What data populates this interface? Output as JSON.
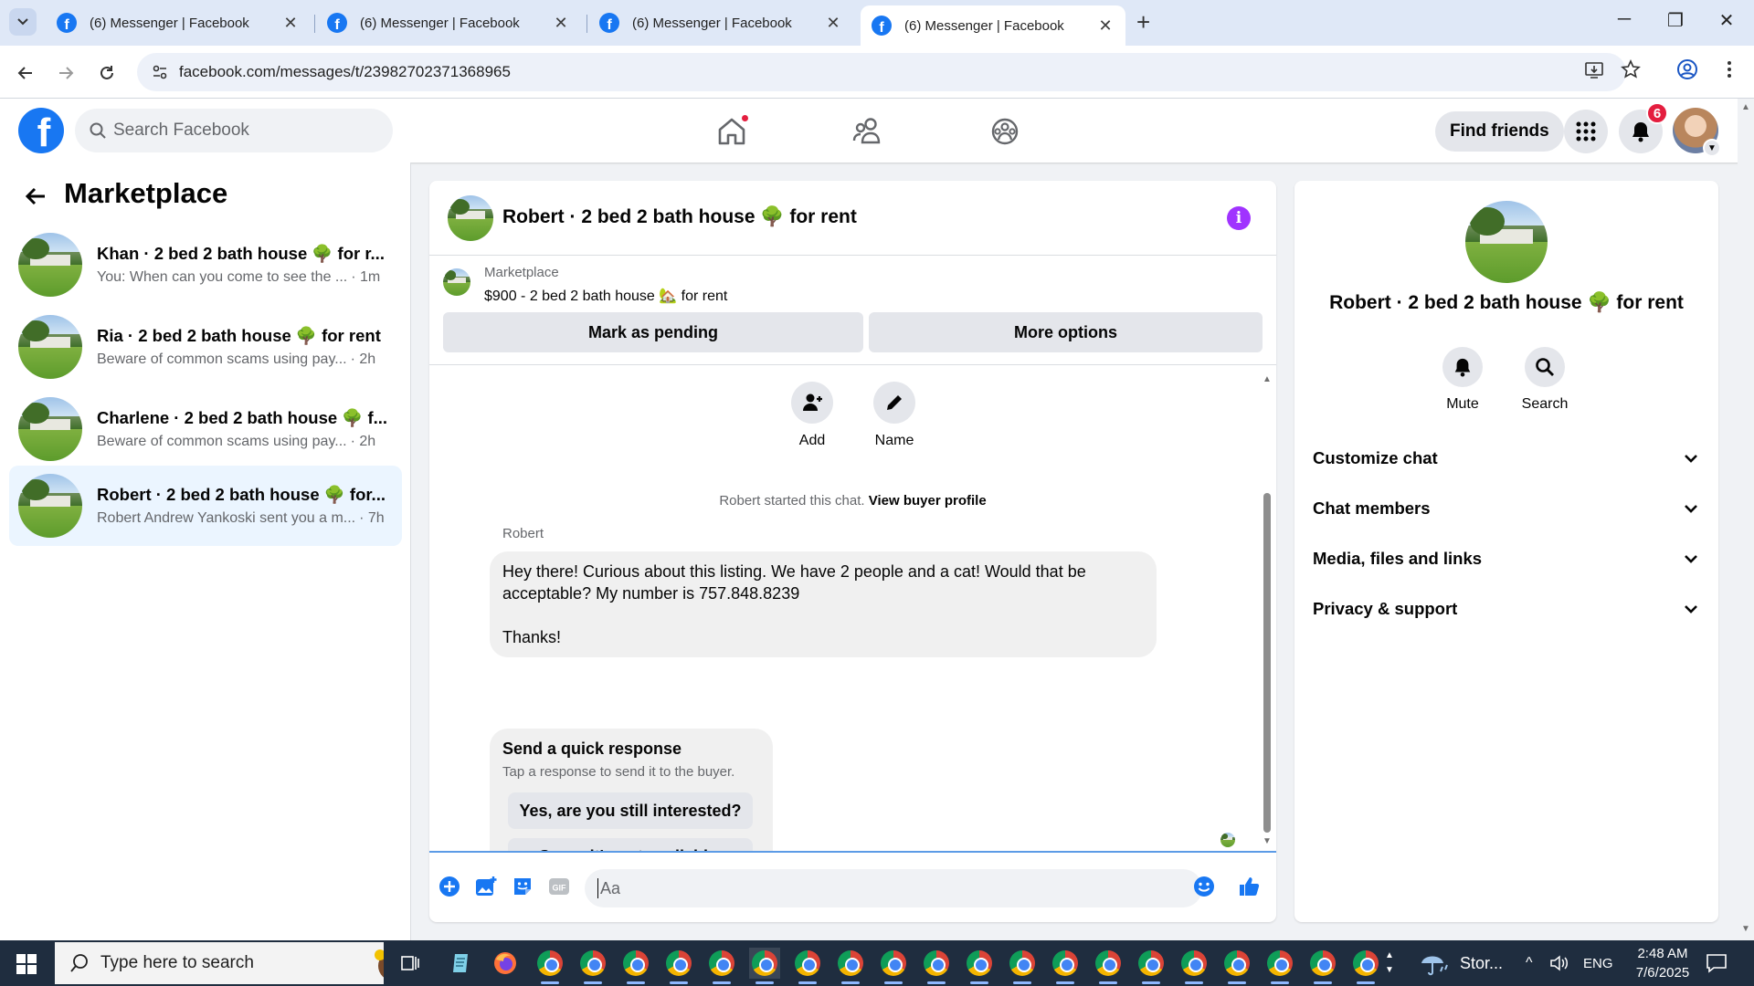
{
  "browser": {
    "tabs": [
      {
        "title": "(6) Messenger | Facebook",
        "active": false
      },
      {
        "title": "(6) Messenger | Facebook",
        "active": false
      },
      {
        "title": "(6) Messenger | Facebook",
        "active": false
      },
      {
        "title": "(6) Messenger | Facebook",
        "active": true
      }
    ],
    "url": "facebook.com/messages/t/23982702371368965"
  },
  "fb_header": {
    "search_placeholder": "Search Facebook",
    "find_friends": "Find friends",
    "notifications_count": "6"
  },
  "left_panel": {
    "title": "Marketplace",
    "conversations": [
      {
        "name": "Khan · 2 bed 2 bath house 🌳 for r...",
        "snippet": "You: When can you come to see the ...",
        "time": "· 1m",
        "active": false
      },
      {
        "name": "Ria · 2 bed 2 bath house 🌳 for rent",
        "snippet": "Beware of common scams using pay...",
        "time": "· 2h",
        "active": false
      },
      {
        "name": "Charlene · 2 bed 2 bath house 🌳 f...",
        "snippet": "Beware of common scams using pay...",
        "time": "· 2h",
        "active": false
      },
      {
        "name": "Robert · 2 bed 2 bath house 🌳 for...",
        "snippet": "Robert Andrew Yankoski sent you a m...",
        "time": "· 7h",
        "active": true
      }
    ]
  },
  "chat": {
    "title": "Robert · 2 bed 2 bath house 🌳 for rent",
    "listing_category": "Marketplace",
    "listing_title": "$900 - 2 bed 2 bath house 🏡 for rent",
    "mark_pending": "Mark as pending",
    "more_options": "More options",
    "actions": {
      "add": "Add",
      "name": "Name"
    },
    "started_text": "Robert started this chat.",
    "view_profile": "View buyer profile",
    "sender": "Robert",
    "message_lines": [
      "Hey there! Curious about this listing. We have 2 people and a cat! Would that be acceptable? My number is 757.848.8239",
      "Thanks!"
    ],
    "quick_title": "Send a quick response",
    "quick_sub": "Tap a response to send it to the buyer.",
    "quick_1": "Yes, are you still interested?",
    "quick_2": "Sorry, it's not available.",
    "composer_placeholder": "Aa"
  },
  "right_panel": {
    "name": "Robert · 2 bed 2 bath house 🌳 for rent",
    "mute": "Mute",
    "search": "Search",
    "rows": [
      "Customize chat",
      "Chat members",
      "Media, files and links",
      "Privacy & support"
    ]
  },
  "taskbar": {
    "search_placeholder": "Type here to search",
    "weather": "Stor...",
    "lang": "ENG",
    "time": "2:48 AM",
    "date": "7/6/2025"
  },
  "colors": {
    "fb_blue": "#1877f2",
    "purple_info": "#a033ff",
    "badge_red": "#e41e3f",
    "active_conv": "#ebf5ff"
  }
}
